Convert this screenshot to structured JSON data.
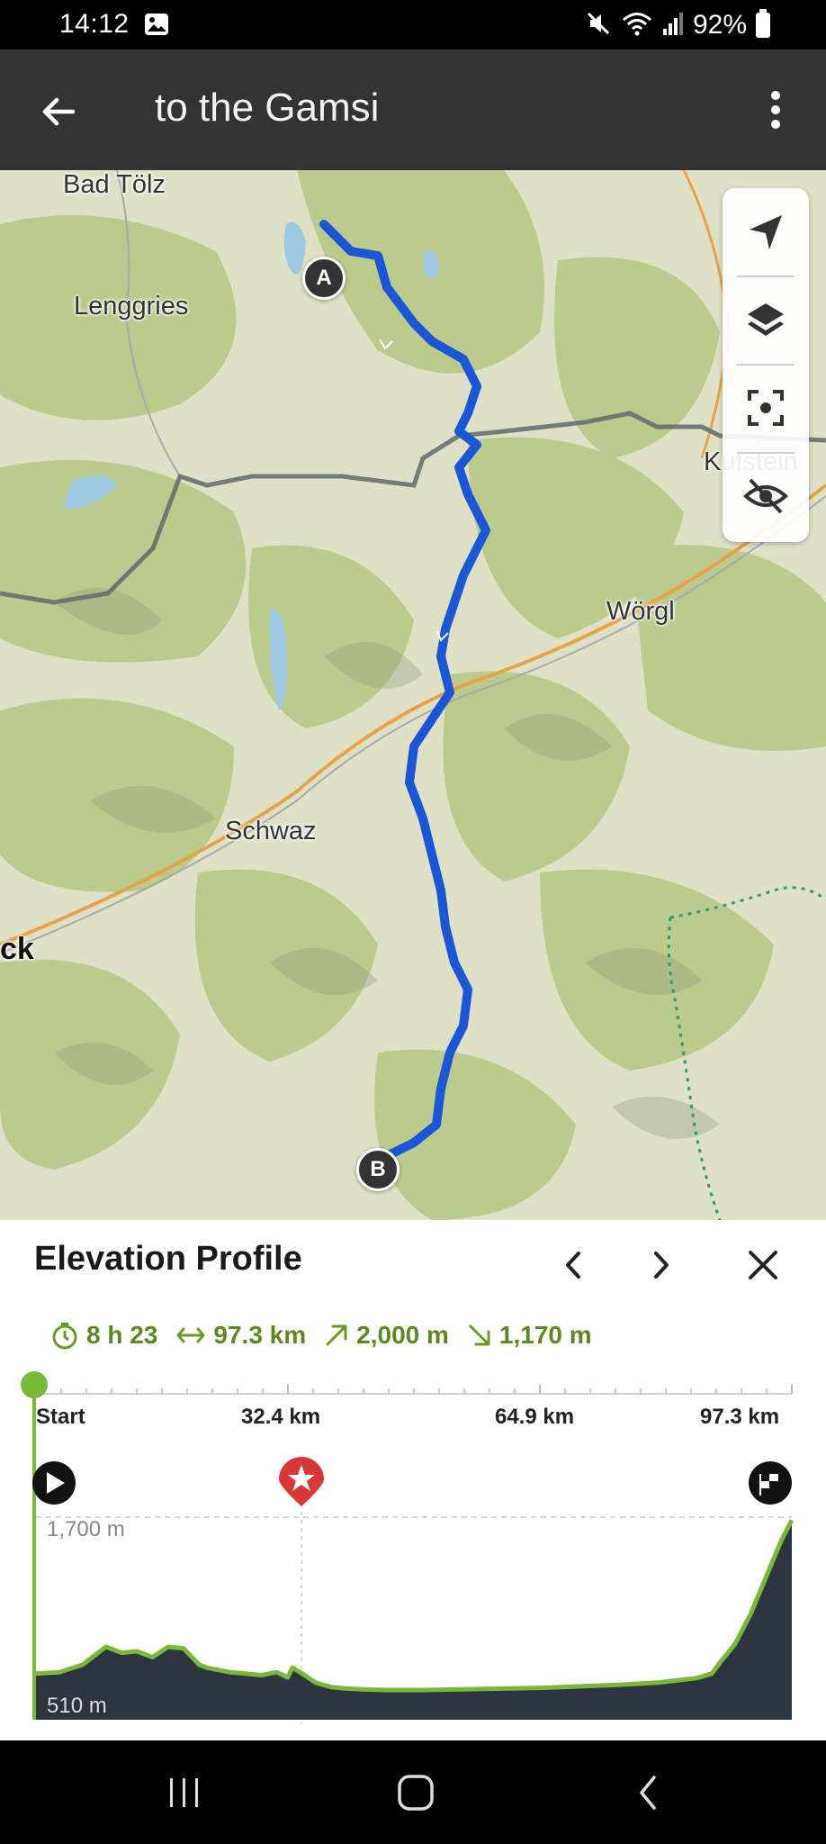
{
  "status_bar": {
    "time": "14:12",
    "battery": "92%",
    "icons": [
      "gallery-icon",
      "mute-icon",
      "wifi-icon",
      "signal-icon",
      "battery-icon"
    ]
  },
  "app_bar": {
    "title": "to the Gamsi",
    "back_icon": "arrow-left-icon",
    "menu_icon": "more-vert-icon"
  },
  "map": {
    "labels": {
      "bad_tolz": "Bad Tölz",
      "lenggries": "Lenggries",
      "kufstein": "Kufstein",
      "worgl": "Wörgl",
      "schwaz": "Schwaz",
      "innsbruck_partial": "ck"
    },
    "start_marker": "A",
    "end_marker": "B",
    "route_color": "#1a56d6",
    "controls": [
      "navigation-arrow-icon",
      "layers-icon",
      "focus-icon",
      "hide-icon"
    ]
  },
  "elevation_panel": {
    "title": "Elevation Profile",
    "prev_icon": "chevron-left-icon",
    "next_icon": "chevron-right-icon",
    "close_icon": "close-icon",
    "stats": {
      "duration": "8 h 23",
      "distance": "97.3 km",
      "ascent": "2,000 m",
      "descent": "1,170 m"
    },
    "accent_color": "#6b9a24",
    "km_labels": {
      "start": "Start",
      "k1": "32.4 km",
      "k2": "64.9 km",
      "end": "97.3 km"
    },
    "elev_top": "1,700 m",
    "elev_bottom": "510 m"
  },
  "chart_data": {
    "type": "area",
    "title": "Elevation Profile",
    "xlabel": "",
    "ylabel": "",
    "x_ticks": [
      "Start",
      "32.4 km",
      "64.9 km",
      "97.3 km"
    ],
    "y_labels": [
      "1,700 m",
      "510 m"
    ],
    "xlim": [
      0,
      97.3
    ],
    "ylim": [
      450,
      1800
    ],
    "series": [
      {
        "x": [
          0,
          3,
          6,
          9,
          11,
          13,
          15,
          17,
          19,
          21,
          22,
          23,
          25,
          27,
          29,
          31,
          32.4,
          33,
          34,
          36,
          38,
          40,
          42,
          45,
          50,
          55,
          60,
          65,
          70,
          75,
          80,
          85,
          87,
          88,
          90,
          92,
          94,
          96,
          97.3
        ],
        "y": [
          650,
          660,
          710,
          830,
          790,
          800,
          760,
          830,
          820,
          710,
          690,
          680,
          660,
          650,
          640,
          660,
          625,
          690,
          660,
          590,
          560,
          550,
          545,
          540,
          540,
          545,
          550,
          555,
          565,
          575,
          590,
          620,
          650,
          720,
          850,
          1050,
          1300,
          1550,
          1680
        ]
      }
    ],
    "markers": [
      {
        "x": 0,
        "label": "start"
      },
      {
        "x": 32.4,
        "label": "highlight"
      },
      {
        "x": 97.3,
        "label": "finish"
      }
    ],
    "grid": true
  },
  "nav_bar": {
    "icons": [
      "recent-apps-icon",
      "home-icon",
      "back-icon"
    ]
  }
}
